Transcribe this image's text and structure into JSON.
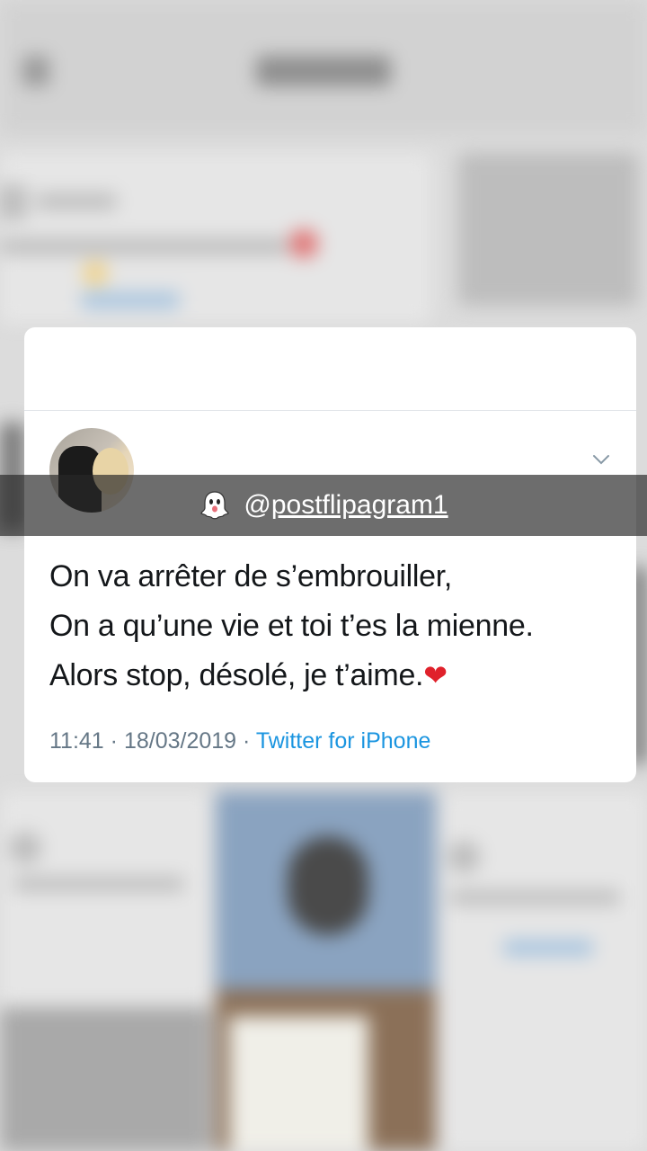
{
  "tweet": {
    "lines": [
      "On va arrêter de s’embrouiller,",
      "On a qu’une vie et toi t’es la mienne.",
      "Alors stop, désolé, je t’aime."
    ],
    "heart_icon": "red-heart-icon",
    "time": "11:41",
    "date": "18/03/2019",
    "separator": "·",
    "source": "Twitter for iPhone",
    "source_color": "#1b95e0",
    "menu_icon": "chevron-down-icon"
  },
  "caption": {
    "icon": "ghost-icon",
    "at": "@",
    "handle": "postflipagram1"
  }
}
